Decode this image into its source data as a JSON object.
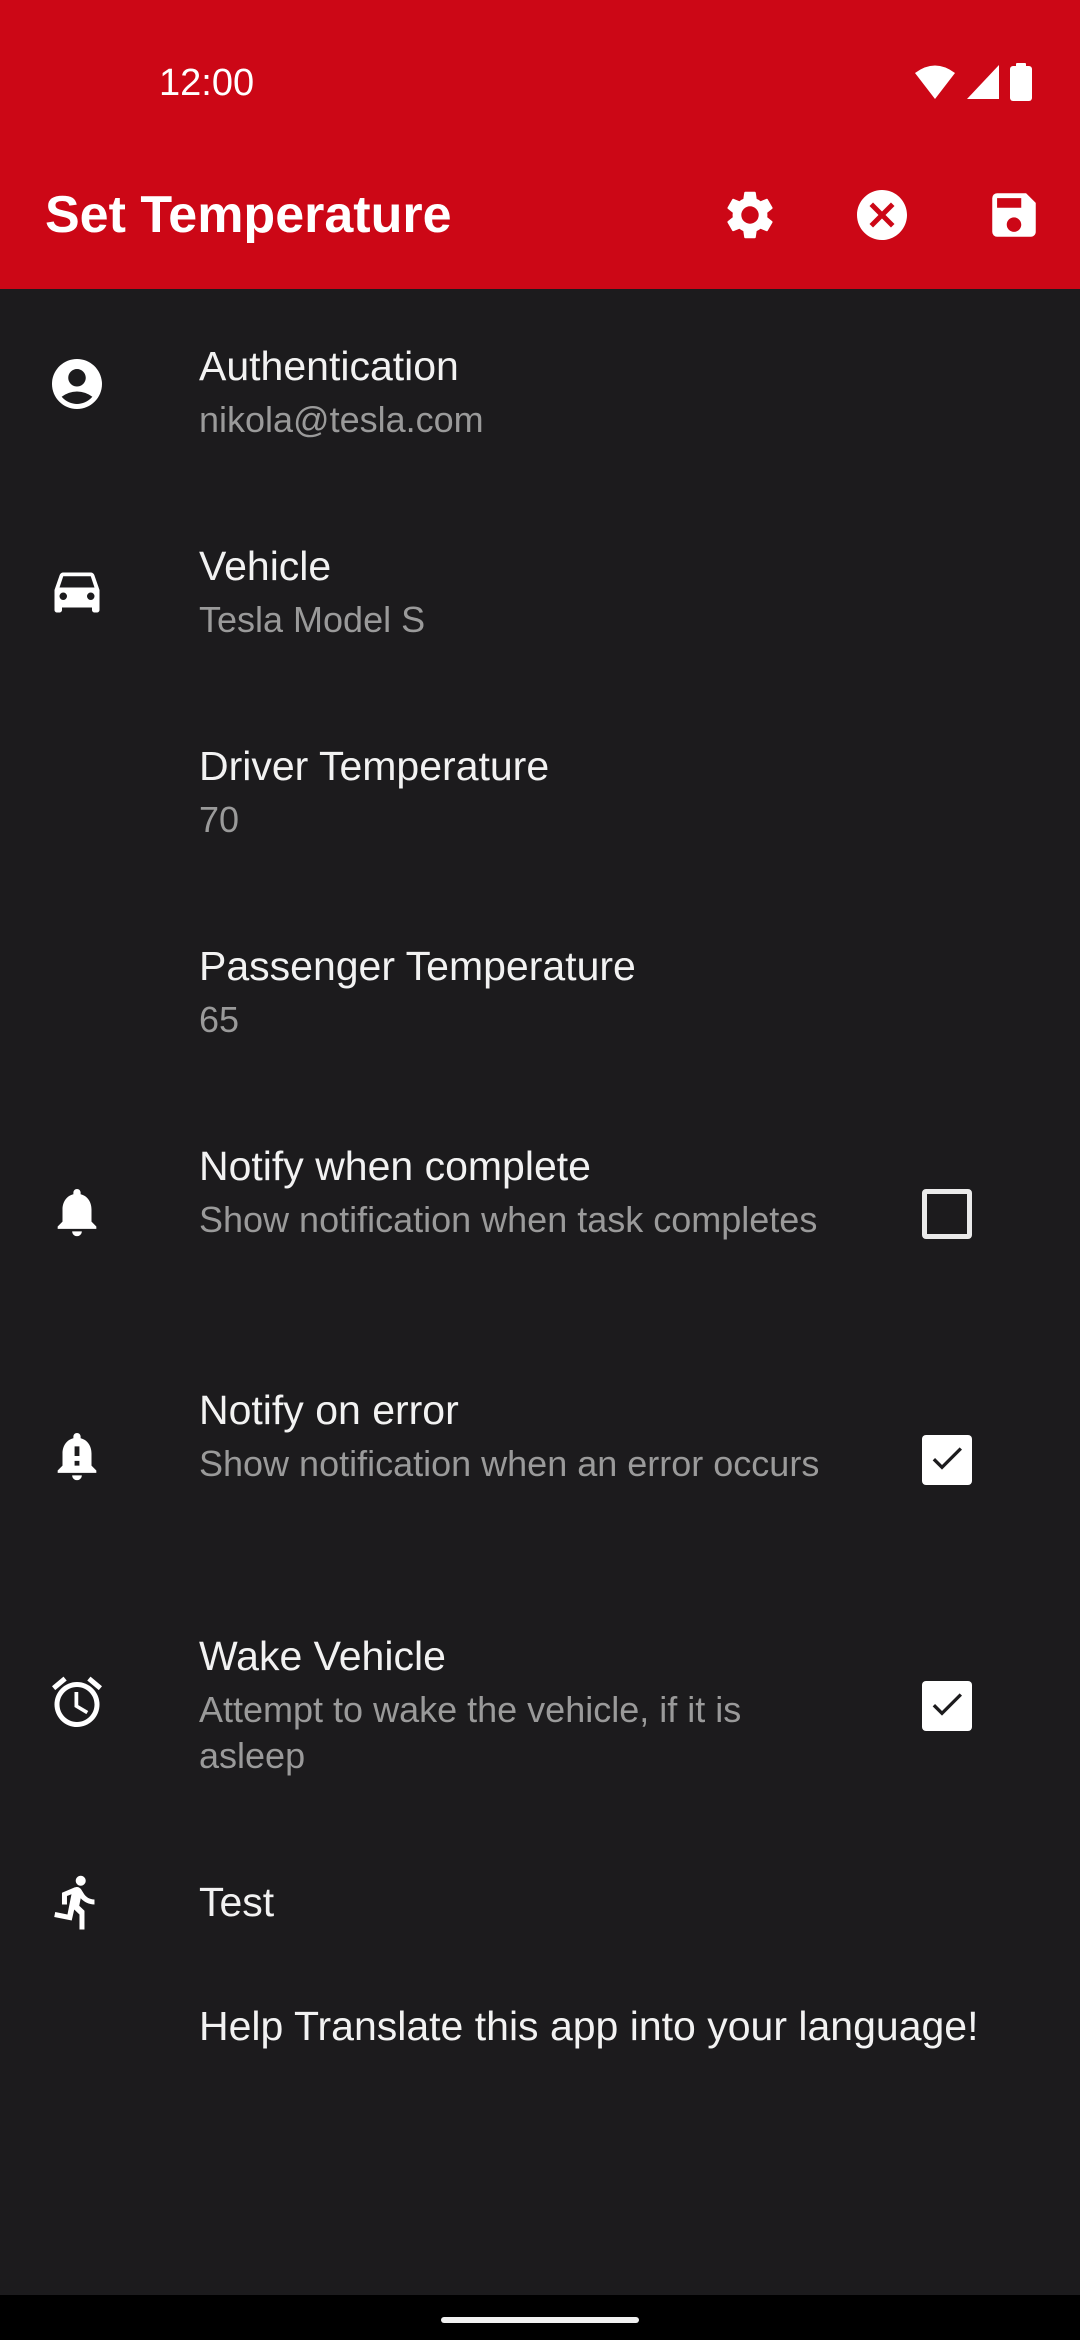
{
  "status_bar": {
    "time": "12:00",
    "icons": [
      "wifi-icon",
      "cellular-signal-icon",
      "battery-icon"
    ]
  },
  "app_bar": {
    "title": "Set Temperature",
    "actions": [
      "gear-icon",
      "cancel-circle-icon",
      "save-floppy-icon"
    ],
    "background_color": "#cc0716"
  },
  "settings": {
    "authentication": {
      "icon": "account-circle-icon",
      "title": "Authentication",
      "subtitle": "nikola@tesla.com"
    },
    "vehicle": {
      "icon": "car-icon",
      "title": "Vehicle",
      "subtitle": "Tesla Model S"
    },
    "driver_temperature": {
      "title": "Driver Temperature",
      "subtitle": "70"
    },
    "passenger_temperature": {
      "title": "Passenger Temperature",
      "subtitle": "65"
    },
    "notify_complete": {
      "icon": "bell-icon",
      "title": "Notify when complete",
      "subtitle": "Show notification when task completes",
      "checked": false
    },
    "notify_error": {
      "icon": "bell-alert-icon",
      "title": "Notify on error",
      "subtitle": "Show notification when an error occurs",
      "checked": true
    },
    "wake_vehicle": {
      "icon": "alarm-clock-icon",
      "title": "Wake Vehicle",
      "subtitle": "Attempt to wake the vehicle, if it is asleep",
      "checked": true
    },
    "test": {
      "icon": "running-person-icon",
      "title": "Test"
    },
    "translate": {
      "title": "Help Translate this app into your language!"
    }
  },
  "colors": {
    "background": "#1c1b1d",
    "secondary_text": "#9a9a9a"
  }
}
